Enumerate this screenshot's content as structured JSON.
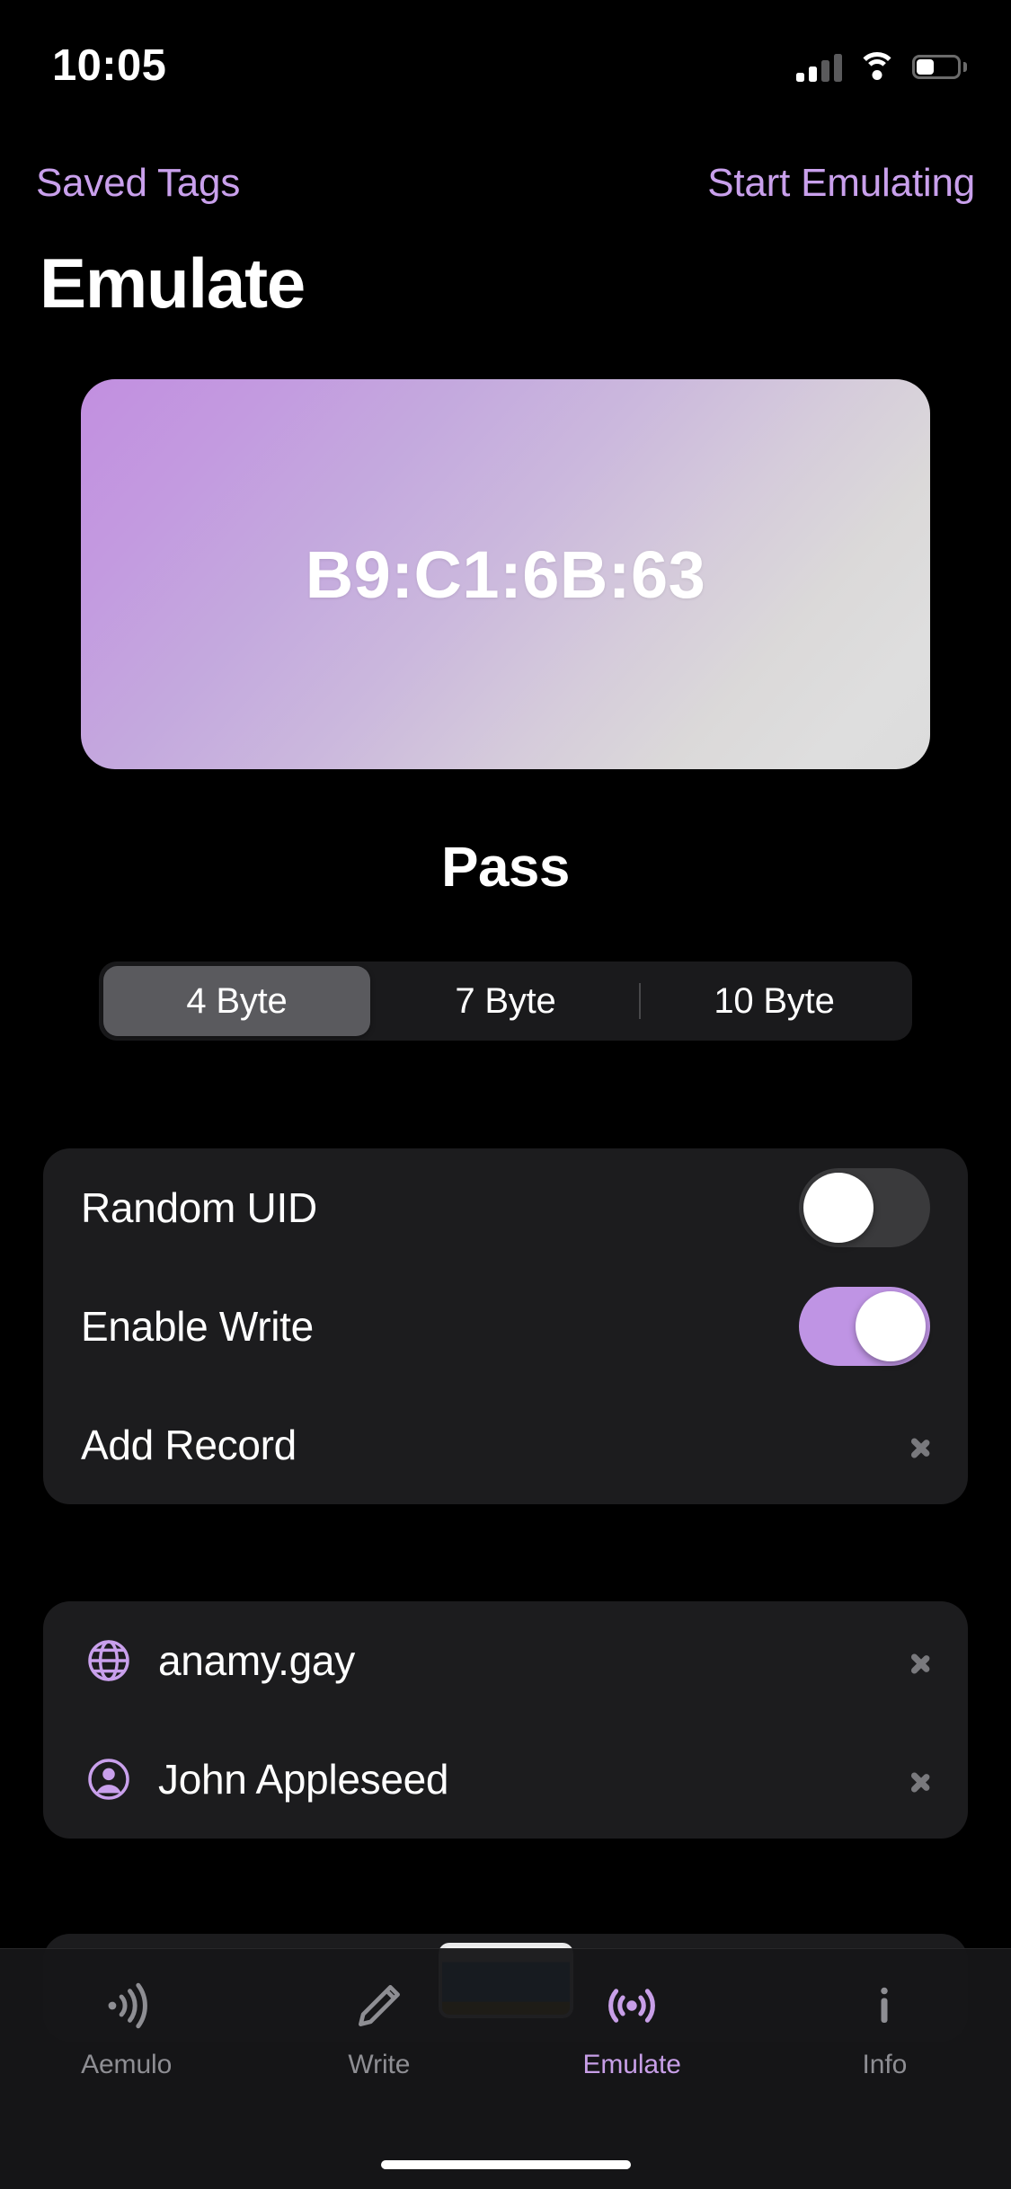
{
  "status_bar": {
    "time": "10:05",
    "signal_icon": "cellular-signal-icon",
    "signal_bars_filled": 2,
    "wifi_icon": "wifi-icon",
    "battery_icon": "battery-icon",
    "battery_level_percent": 35
  },
  "nav_bar": {
    "left_button": "Saved Tags",
    "right_button": "Start Emulating",
    "accent_color": "#C9A0EC"
  },
  "header": {
    "title": "Emulate"
  },
  "tag_card": {
    "uid": "B9:C1:6B:63",
    "gradient_from": "#C28FE0",
    "gradient_to": "#DEDEDE"
  },
  "tag_name": "Pass",
  "segmented_control": {
    "options": [
      "4 Byte",
      "7 Byte",
      "10 Byte"
    ],
    "selected": "4 Byte",
    "selected_index": 0
  },
  "settings_group": {
    "rows": [
      {
        "label": "Random UID",
        "control": "toggle",
        "value": "off"
      },
      {
        "label": "Enable Write",
        "control": "toggle",
        "value": "on"
      },
      {
        "label": "Add Record",
        "control": "chevron"
      }
    ],
    "toggle_on_color": "#BF94E4",
    "toggle_off_color": "#3A3A3C"
  },
  "records_group": {
    "rows": [
      {
        "label": "anamy.gay",
        "icon": "globe-icon"
      },
      {
        "label": "John Appleseed",
        "icon": "person-circle-icon"
      }
    ],
    "icon_color": "#C9A0EC"
  },
  "tab_bar": {
    "tabs": [
      {
        "label": "Aemulo",
        "icon": "nfc-wave-icon",
        "active": false
      },
      {
        "label": "Write",
        "icon": "pencil-icon",
        "active": false
      },
      {
        "label": "Emulate",
        "icon": "broadcast-icon",
        "active": true
      },
      {
        "label": "Info",
        "icon": "info-icon",
        "active": false
      }
    ],
    "active_color": "#C89FE8",
    "inactive_color": "#8E8E93"
  }
}
